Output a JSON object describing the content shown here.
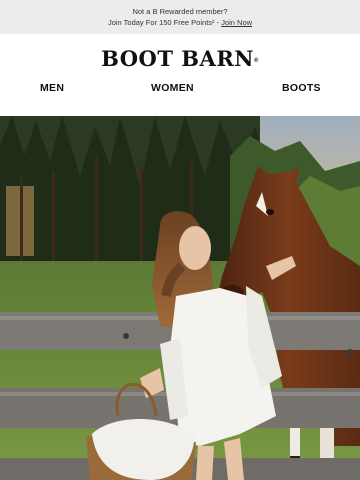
{
  "promo": {
    "line1": "Not a B Rewarded member?",
    "line2_prefix": "Join Today For 150 Free Points",
    "line2_mark": "²",
    "line2_sep": " - ",
    "join_link": "Join Now"
  },
  "brand": {
    "logo_text": "BOOT BARN",
    "registered_mark": "®"
  },
  "nav": {
    "items": [
      {
        "label": "MEN"
      },
      {
        "label": "WOMEN"
      },
      {
        "label": "BOOTS"
      }
    ]
  },
  "hero": {
    "image_subject": "woman-with-horse-at-fence"
  },
  "colors": {
    "promo_bg": "#ececec",
    "text_dark": "#111111",
    "grass": "#6f8a3e",
    "horse": "#6b3418",
    "fence": "#7d7a76"
  }
}
